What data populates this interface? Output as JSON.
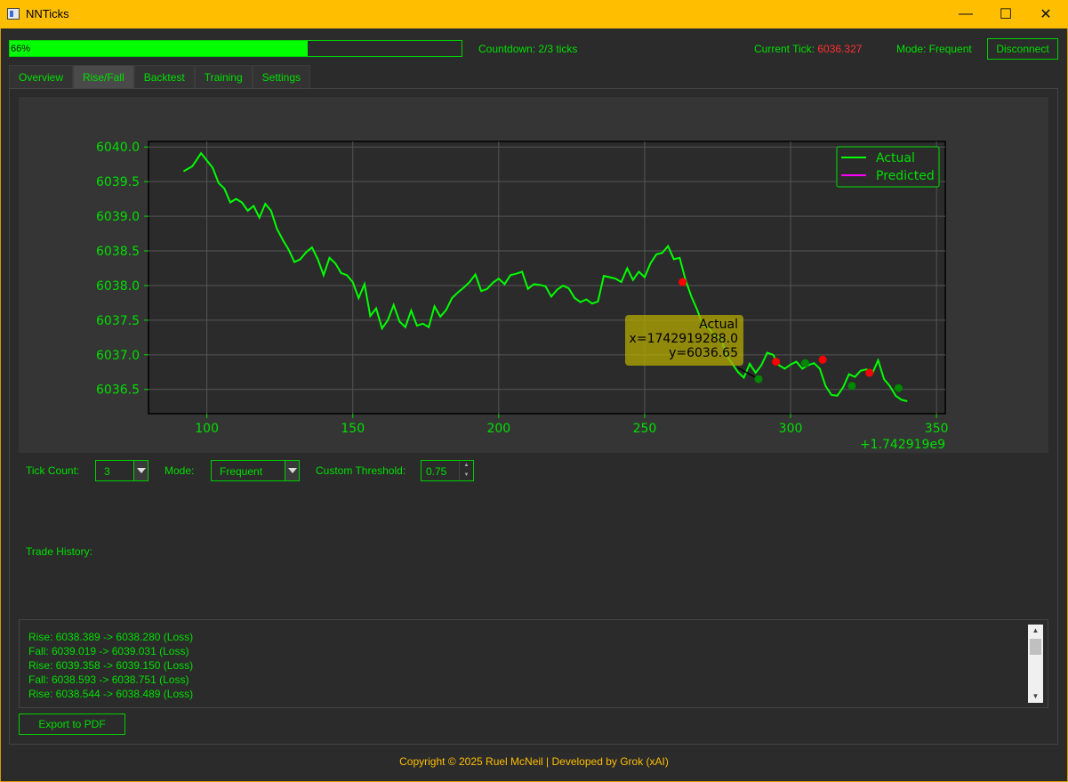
{
  "window": {
    "title": "NNTicks",
    "minimize": "—",
    "maximize": "☐",
    "close": "✕"
  },
  "progress": {
    "value": 66,
    "label": "66%"
  },
  "status": {
    "countdown": "Countdown: 2/3 ticks",
    "current_tick_label": "Current Tick:",
    "current_tick_value": "6036.327",
    "mode": "Mode: Frequent"
  },
  "disconnect_label": "Disconnect",
  "tabs": [
    {
      "label": "Overview",
      "active": false
    },
    {
      "label": "Rise/Fall",
      "active": true
    },
    {
      "label": "Backtest",
      "active": false
    },
    {
      "label": "Training",
      "active": false
    },
    {
      "label": "Settings",
      "active": false
    }
  ],
  "chart_data": {
    "type": "line",
    "x_offset_label": "+1.742919e9",
    "xlim": [
      80,
      353
    ],
    "ylim": [
      6036.15,
      6040.08
    ],
    "x_ticks": [
      100,
      150,
      200,
      250,
      300,
      350
    ],
    "y_ticks": [
      6036.5,
      6037.0,
      6037.5,
      6038.0,
      6038.5,
      6039.0,
      6039.5,
      6040.0
    ],
    "y_tick_labels": [
      "6036.5",
      "6037.0",
      "6037.5",
      "6038.0",
      "6038.5",
      "6039.0",
      "6039.5",
      "6040.0"
    ],
    "grid": true,
    "legend_position": "top-right",
    "colors": {
      "actual": "#00ff00",
      "predicted": "#ff00ff",
      "loss_marker": "#ff0000",
      "win_marker": "#008800"
    },
    "series": [
      {
        "name": "Actual",
        "x": [
          92,
          95,
          98,
          102,
          104,
          106,
          108,
          110,
          112,
          114,
          116,
          118,
          120,
          122,
          124,
          126,
          128,
          130,
          132,
          134,
          136,
          138,
          140,
          142,
          144,
          146,
          148,
          150,
          152,
          154,
          156,
          158,
          160,
          162,
          164,
          166,
          168,
          170,
          172,
          174,
          176,
          178,
          180,
          182,
          184,
          186,
          188,
          190,
          192,
          194,
          196,
          198,
          200,
          202,
          204,
          206,
          208,
          210,
          212,
          214,
          216,
          218,
          220,
          222,
          224,
          226,
          228,
          230,
          232,
          234,
          236,
          238,
          240,
          242,
          244,
          246,
          248,
          250,
          252,
          254,
          256,
          258,
          260,
          262,
          264,
          266,
          268,
          270,
          272,
          274,
          276,
          278,
          280,
          282,
          284,
          286,
          288,
          290,
          292,
          294,
          296,
          298,
          300,
          302,
          304,
          306,
          308,
          310,
          312,
          314,
          316,
          318,
          320,
          322,
          324,
          326,
          328,
          330,
          332,
          334,
          336,
          338,
          340
        ],
        "y": [
          6039.65,
          6039.72,
          6039.91,
          6039.7,
          6039.48,
          6039.4,
          6039.2,
          6039.25,
          6039.2,
          6039.08,
          6039.15,
          6038.98,
          6039.18,
          6039.08,
          6038.82,
          6038.66,
          6038.52,
          6038.34,
          6038.38,
          6038.48,
          6038.55,
          6038.38,
          6038.15,
          6038.4,
          6038.32,
          6038.18,
          6038.15,
          6038.05,
          6037.82,
          6038.02,
          6037.56,
          6037.67,
          6037.38,
          6037.5,
          6037.72,
          6037.48,
          6037.4,
          6037.64,
          6037.42,
          6037.45,
          6037.4,
          6037.7,
          6037.55,
          6037.65,
          6037.82,
          6037.9,
          6037.97,
          6038.05,
          6038.16,
          6037.92,
          6037.95,
          6038.04,
          6038.1,
          6038.02,
          6038.15,
          6038.17,
          6038.2,
          6037.95,
          6038.02,
          6038.01,
          6037.99,
          6037.84,
          6037.94,
          6038.0,
          6037.96,
          6037.82,
          6037.76,
          6037.8,
          6037.74,
          6037.77,
          6038.14,
          6038.12,
          6038.1,
          6038.05,
          6038.25,
          6038.08,
          6038.2,
          6038.12,
          6038.32,
          6038.45,
          6038.47,
          6038.57,
          6038.38,
          6038.4,
          6038.08,
          6037.84,
          6037.65,
          6037.42,
          6037.38,
          6037.28,
          6037.25,
          6037.0,
          6036.87,
          6036.75,
          6036.67,
          6036.87,
          6036.74,
          6036.85,
          6037.03,
          6037.0,
          6036.85,
          6036.8,
          6036.86,
          6036.9,
          6036.8,
          6036.85,
          6036.88,
          6036.8,
          6036.55,
          6036.42,
          6036.41,
          6036.53,
          6036.72,
          6036.68,
          6036.77,
          6036.79,
          6036.73,
          6036.92,
          6036.65,
          6036.55,
          6036.41,
          6036.35,
          6036.33
        ]
      },
      {
        "name": "Predicted",
        "x": [],
        "y": []
      }
    ],
    "markers": [
      {
        "x": 263,
        "y": 6038.05,
        "outcome": "loss"
      },
      {
        "x": 289,
        "y": 6036.65,
        "outcome": "win"
      },
      {
        "x": 295,
        "y": 6036.9,
        "outcome": "loss"
      },
      {
        "x": 305,
        "y": 6036.88,
        "outcome": "win"
      },
      {
        "x": 311,
        "y": 6036.93,
        "outcome": "loss"
      },
      {
        "x": 321,
        "y": 6036.55,
        "outcome": "win"
      },
      {
        "x": 327,
        "y": 6036.74,
        "outcome": "loss"
      },
      {
        "x": 337,
        "y": 6036.52,
        "outcome": "win"
      }
    ],
    "tooltip": {
      "series": "Actual",
      "x_text": "x=1742919288.0",
      "y_text": "y=6036.65"
    }
  },
  "controls": {
    "tick_count_label": "Tick Count:",
    "tick_count_value": "3",
    "mode_label": "Mode:",
    "mode_value": "Frequent",
    "threshold_label": "Custom Threshold:",
    "threshold_value": "0.75"
  },
  "history": {
    "label": "Trade History:",
    "entries": [
      "Rise: 6038.389 -> 6038.280 (Loss)",
      "Fall: 6039.019 -> 6039.031 (Loss)",
      "Rise: 6039.358 -> 6039.150 (Loss)",
      "Fall: 6038.593 -> 6038.751 (Loss)",
      "Rise: 6038.544 -> 6038.489 (Loss)"
    ]
  },
  "export_label": "Export to PDF",
  "footer": "Copyright © 2025 Ruel McNeil | Developed by Grok (xAI)"
}
